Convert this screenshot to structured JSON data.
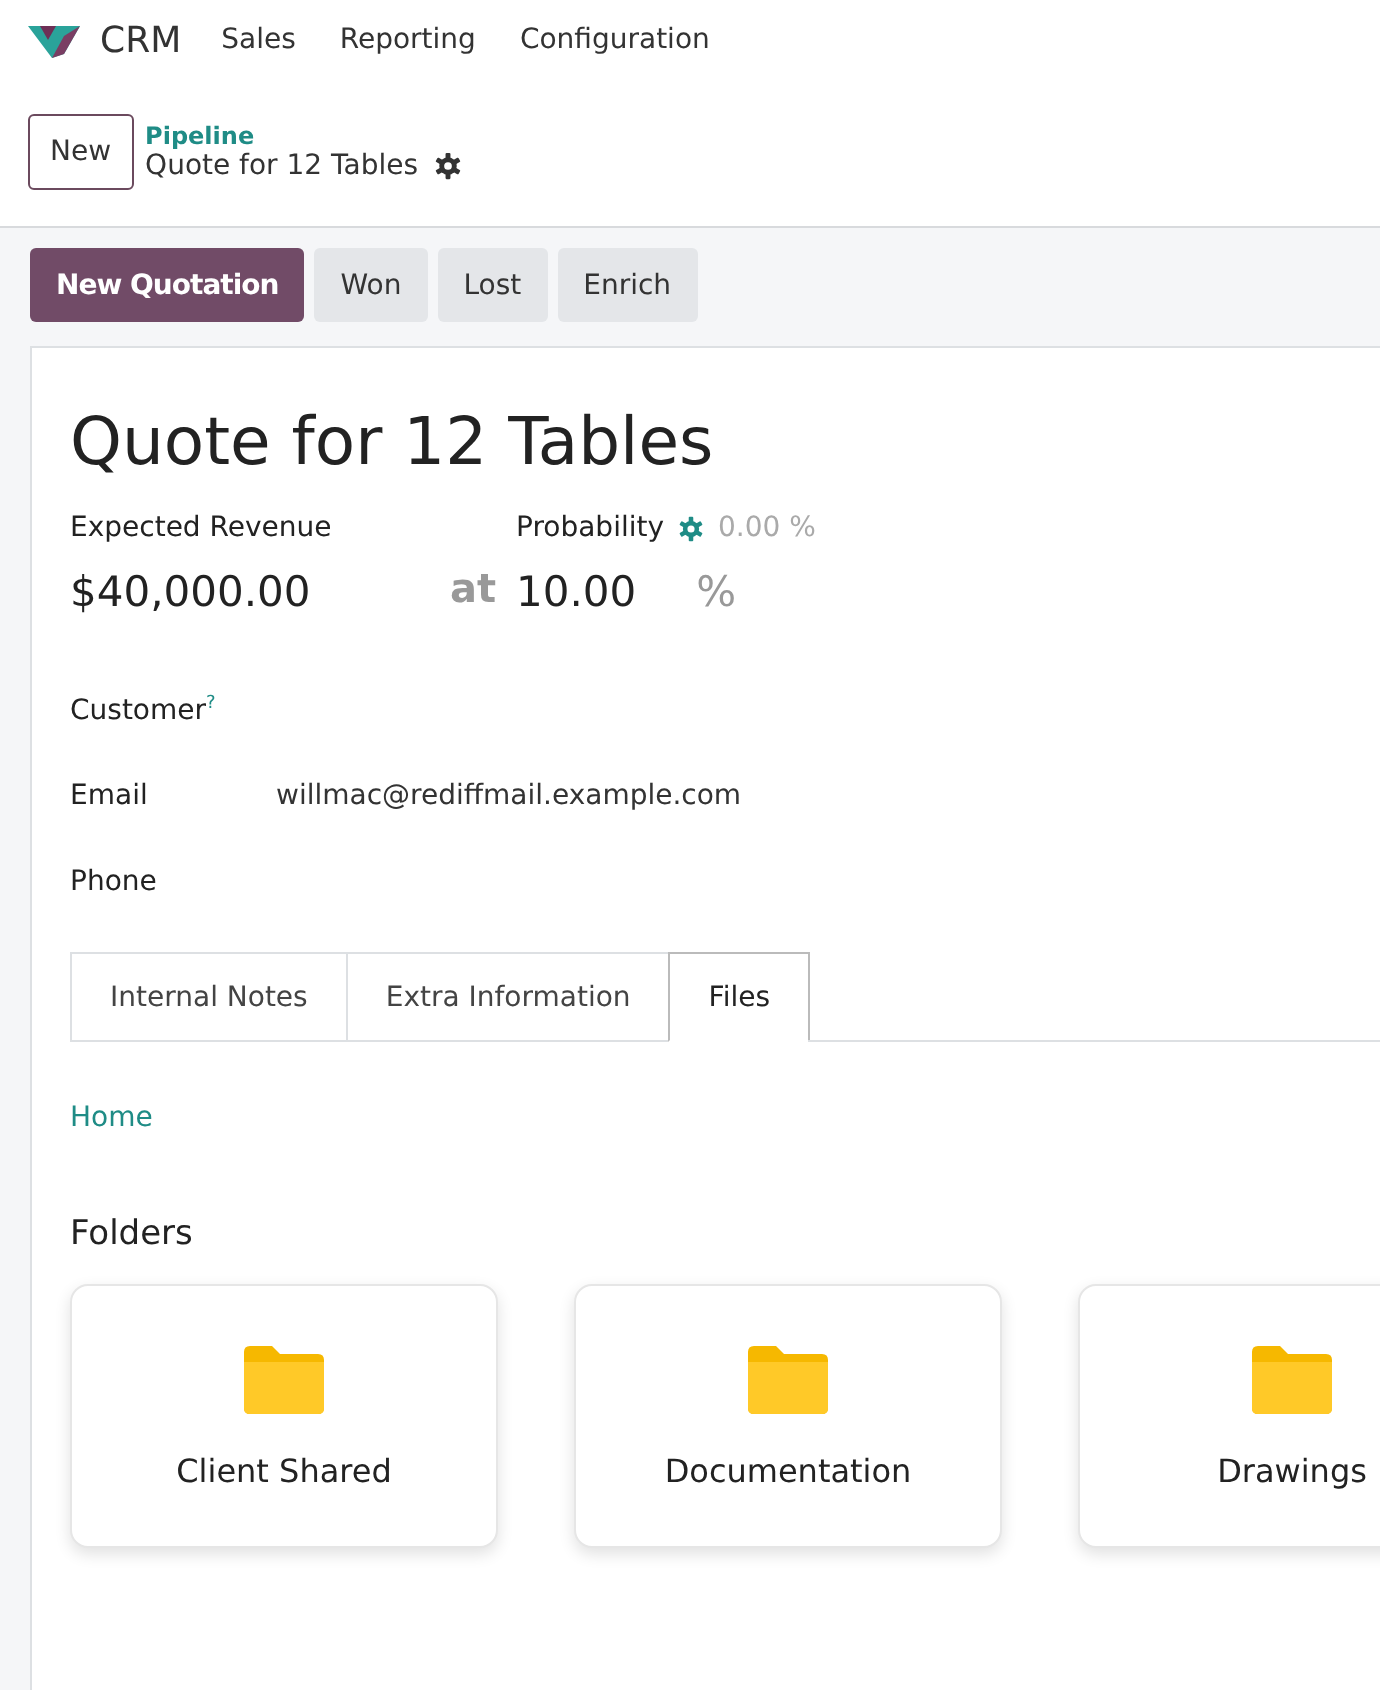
{
  "app": {
    "name": "CRM"
  },
  "menu": [
    "Sales",
    "Reporting",
    "Configuration"
  ],
  "control_panel": {
    "new_button": "New",
    "breadcrumb_parent": "Pipeline",
    "breadcrumb_current": "Quote for 12 Tables"
  },
  "actions": [
    {
      "label": "New Quotation",
      "kind": "primary"
    },
    {
      "label": "Won",
      "kind": "secondary"
    },
    {
      "label": "Lost",
      "kind": "secondary"
    },
    {
      "label": "Enrich",
      "kind": "secondary"
    }
  ],
  "record": {
    "title": "Quote for 12 Tables",
    "revenue_label": "Expected Revenue",
    "revenue_value": "$40,000.00",
    "at": "at",
    "probability_label": "Probability",
    "probability_auto": "0.00 %",
    "probability_value": "10.00",
    "percent": "%"
  },
  "fields": [
    {
      "label": "Customer",
      "help": "?"
    },
    {
      "label": "Email",
      "value": "willmac@rediffmail.example.com"
    },
    {
      "label": "Phone"
    }
  ],
  "tabs": [
    {
      "label": "Internal Notes",
      "selected": false
    },
    {
      "label": "Extra Information",
      "selected": false
    },
    {
      "label": "Files",
      "selected": true
    }
  ],
  "files": {
    "path": "Home",
    "heading": "Folders",
    "folders": [
      "Client Shared",
      "Documentation",
      "Drawings"
    ]
  }
}
